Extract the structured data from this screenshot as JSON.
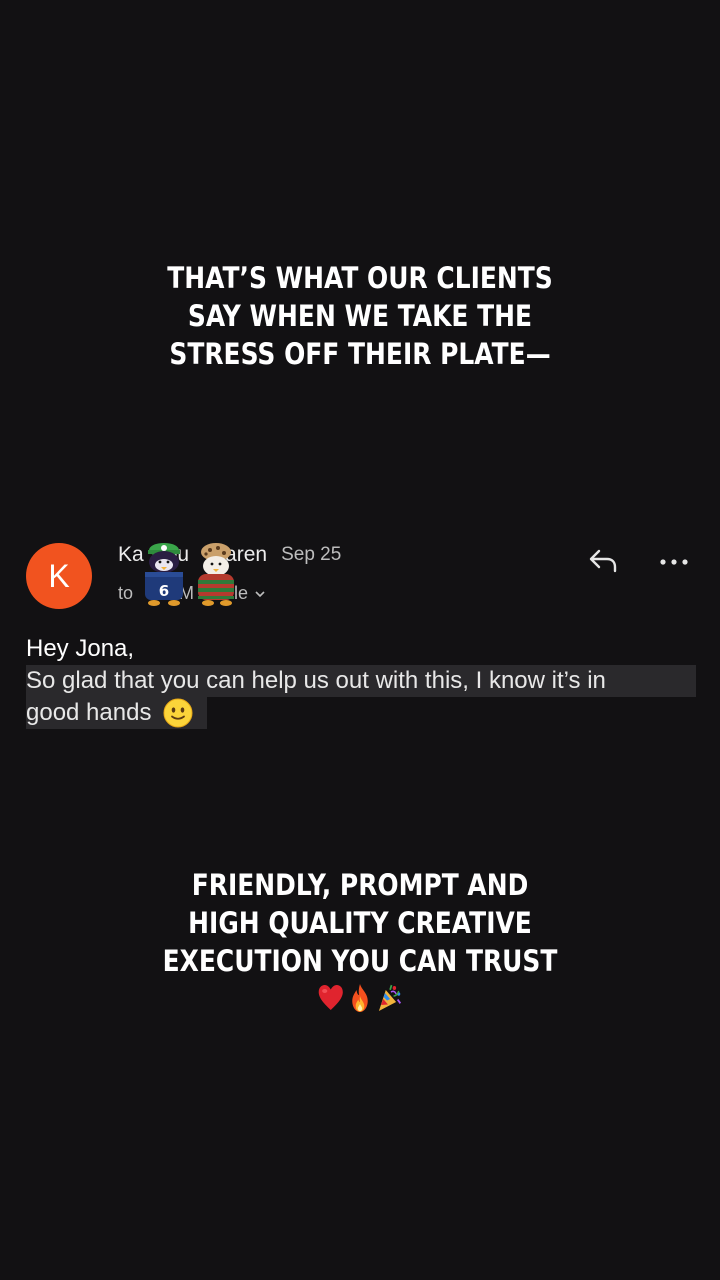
{
  "captions": {
    "top": [
      "THAT’S WHAT OUR CLIENTS",
      "SAY WHEN WE TAKE THE",
      "STRESS OFF THEIR PLATE—"
    ],
    "bottom": [
      "FRIENDLY, PROMPT AND",
      "HIGH QUALITY CREATIVE",
      "EXECUTION YOU CAN TRUST"
    ],
    "bottom_emojis": [
      "red-heart-emoji",
      "fire-emoji",
      "party-popper-emoji"
    ]
  },
  "email": {
    "avatar_letter": "K",
    "avatar_color": "#f1531f",
    "sender_prefix": "Ka",
    "sender_mid": "ou",
    "sender_last": "Karen",
    "date": "Sep 25",
    "to_prefix": "to",
    "to_mid": "M",
    "to_suffix": "lle",
    "chevron": "⌄",
    "greeting": "Hey Jona,",
    "body_line1": "So glad that you can help us out with this, I know it’s in",
    "body_line2": "good hands",
    "icons": [
      "reply-icon",
      "more-options-icon",
      "slightly-smiling-face-emoji"
    ]
  }
}
